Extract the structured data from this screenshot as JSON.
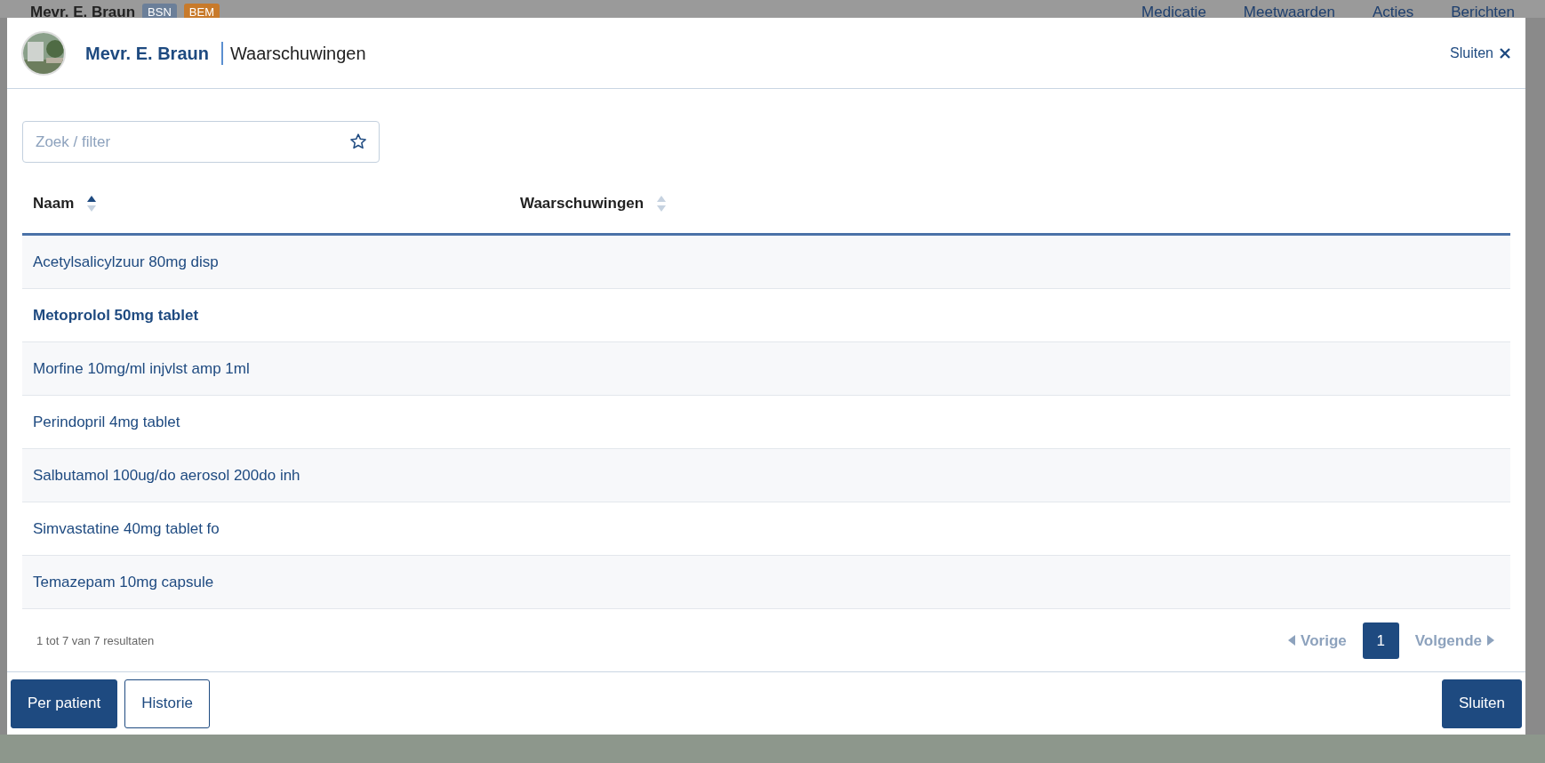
{
  "background_header": {
    "patient_name": "Mevr. E. Braun",
    "badges": [
      {
        "label": "BSN",
        "color": "#6b7f99"
      },
      {
        "label": "BEM",
        "color": "#c87a2a"
      }
    ],
    "nav": [
      "Medicatie",
      "Meetwaarden",
      "Acties",
      "Berichten"
    ]
  },
  "dialog": {
    "patient_name": "Mevr. E. Braun",
    "title": "Waarschuwingen",
    "close_label": "Sluiten",
    "search": {
      "placeholder": "Zoek / filter"
    },
    "table": {
      "columns": [
        {
          "label": "Naam",
          "sorted": true
        },
        {
          "label": "Waarschuwingen",
          "sorted": false
        }
      ],
      "rows": [
        {
          "name": "Acetylsalicylzuur 80mg disp",
          "bold": false
        },
        {
          "name": "Metoprolol 50mg tablet",
          "bold": true
        },
        {
          "name": "Morfine 10mg/ml injvlst amp 1ml",
          "bold": false
        },
        {
          "name": "Perindopril 4mg tablet",
          "bold": false
        },
        {
          "name": "Salbutamol 100ug/do aerosol 200do inh",
          "bold": false
        },
        {
          "name": "Simvastatine 40mg tablet fo",
          "bold": false
        },
        {
          "name": "Temazepam 10mg capsule",
          "bold": false
        }
      ]
    },
    "result_count": "1 tot 7 van 7 resultaten",
    "pagination": {
      "previous": "Vorige",
      "pages": [
        {
          "label": "1",
          "selected": true
        }
      ],
      "next": "Volgende"
    },
    "footer_buttons": [
      {
        "label": "Per patient",
        "kind": "primary"
      },
      {
        "label": "Historie",
        "kind": "outline"
      },
      {
        "label": "Sluiten",
        "kind": "primary"
      }
    ]
  }
}
